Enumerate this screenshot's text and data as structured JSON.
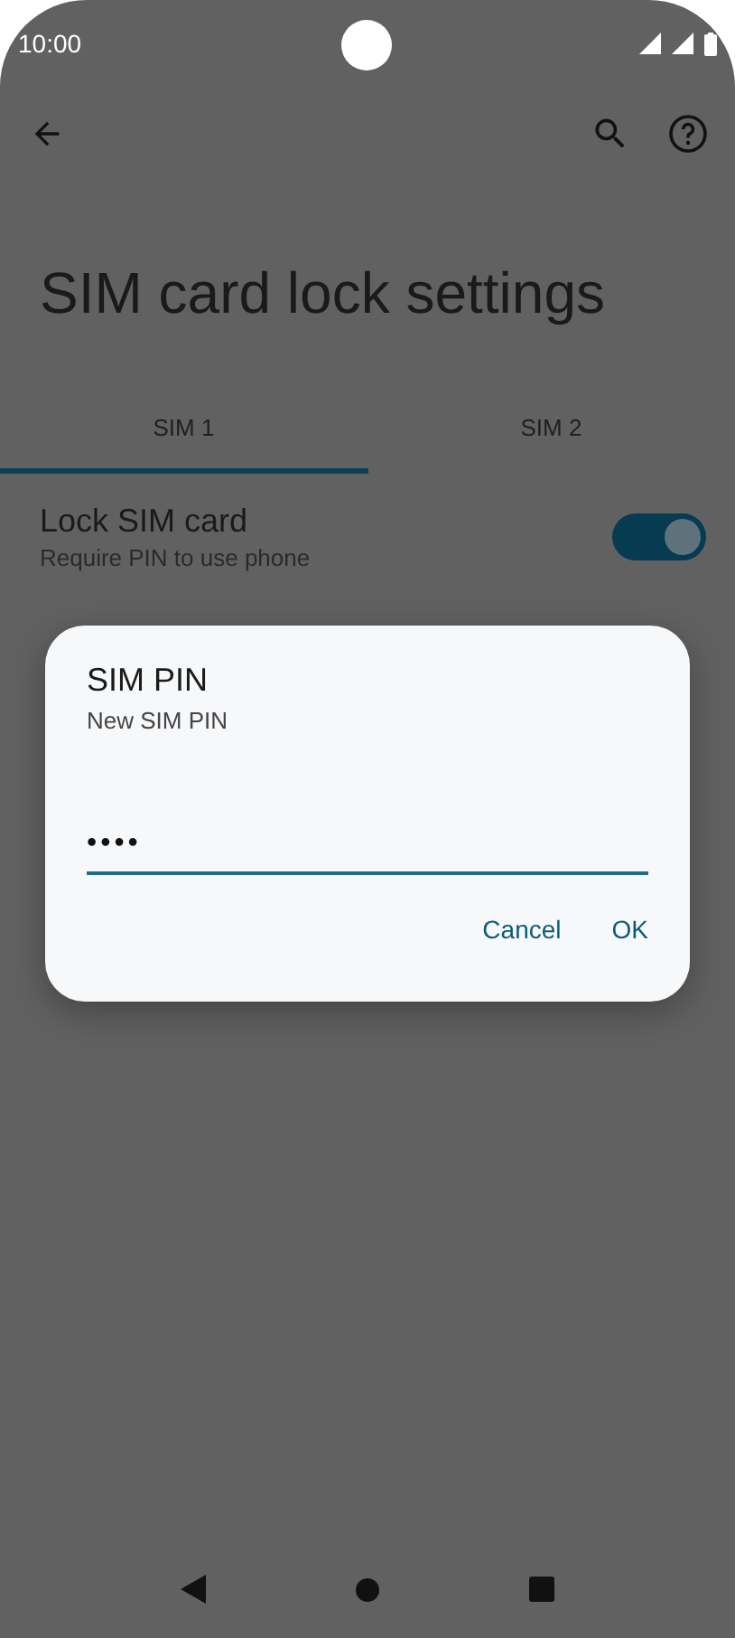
{
  "status_bar": {
    "time": "10:00"
  },
  "title": "SIM card lock settings",
  "tabs": [
    {
      "label": "SIM 1",
      "selected": true
    },
    {
      "label": "SIM 2",
      "selected": false
    }
  ],
  "setting": {
    "title": "Lock SIM card",
    "subtitle": "Require PIN to use phone",
    "on": true
  },
  "dialog": {
    "title": "SIM PIN",
    "subtitle": "New SIM PIN",
    "value": "••••",
    "buttons": [
      "Cancel",
      "OK"
    ]
  }
}
